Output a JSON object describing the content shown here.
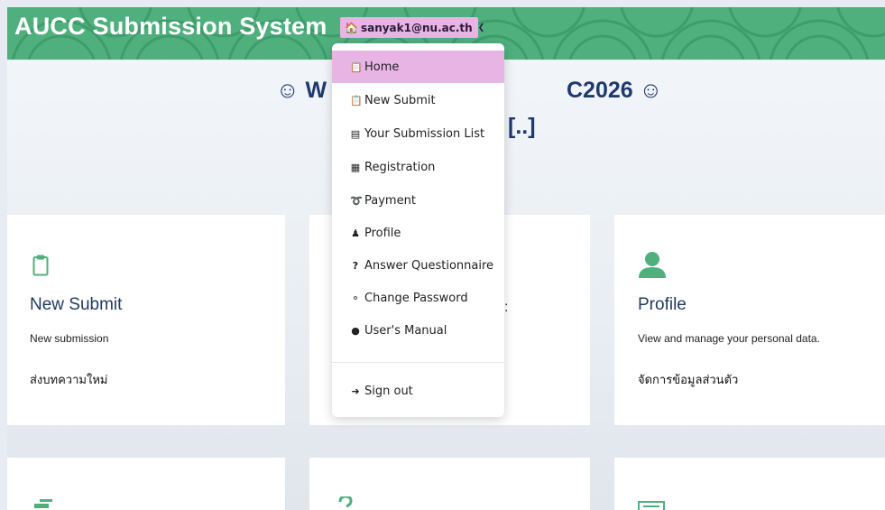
{
  "header": {
    "title": "AUCC Submission System",
    "user_email": "sanyak1@nu.ac.th",
    "colors": {
      "header_bg": "#4fb07e",
      "accent_pink": "#e8b4e4",
      "navy": "#1f3a6e"
    }
  },
  "welcome": {
    "line1_left": "☺ W",
    "line1_right": "C2026 ☺",
    "line2": "[..]"
  },
  "menu": {
    "items": [
      {
        "label": "Home",
        "icon": "clipboard-icon"
      },
      {
        "label": "New Submit",
        "icon": "clipboard-icon"
      },
      {
        "label": "Your Submission List",
        "icon": "list-icon"
      },
      {
        "label": "Registration",
        "icon": "register-icon"
      },
      {
        "label": "Payment",
        "icon": "payment-icon"
      },
      {
        "label": "Profile",
        "icon": "user-icon"
      },
      {
        "label": "Answer Questionnaire",
        "icon": "question-icon"
      },
      {
        "label": "Change Password",
        "icon": "key-icon"
      },
      {
        "label": "User's Manual",
        "icon": "comment-icon"
      },
      {
        "label": "Sign out",
        "icon": "sign-out-icon"
      }
    ],
    "active_index": 0
  },
  "cards": {
    "new_submit": {
      "title": "New Submit",
      "desc": "New submission",
      "thai": "ส่งบทความใหม่"
    },
    "middle": {
      "fragment": ":"
    },
    "profile": {
      "title": "Profile",
      "desc": "View and manage your personal data.",
      "thai": "จัดการข้อมูลส่วนตัว"
    }
  }
}
